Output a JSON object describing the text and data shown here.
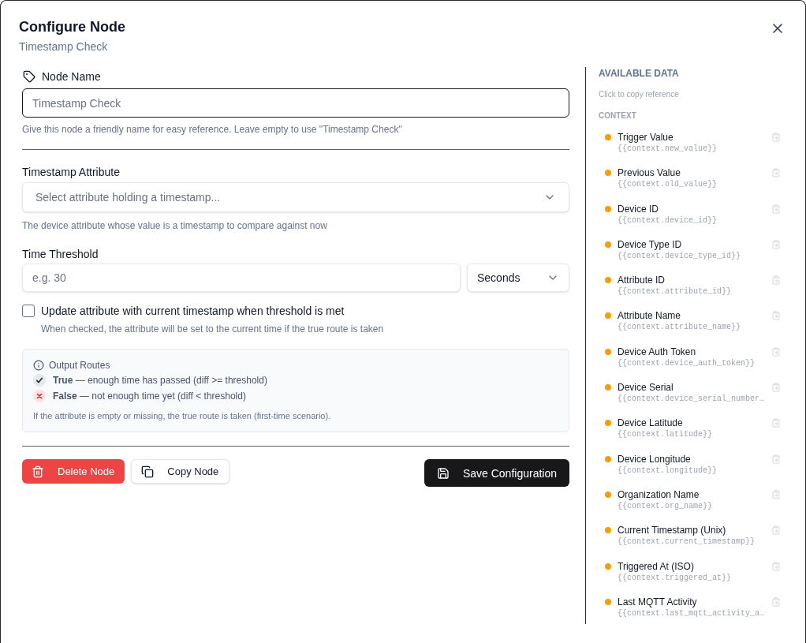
{
  "dialog": {
    "title": "Configure Node",
    "subtitle": "Timestamp Check"
  },
  "form": {
    "node_name": {
      "label": "Node Name",
      "placeholder": "Timestamp Check",
      "focused": true,
      "help": "Give this node a friendly name for easy reference. Leave empty to use \"Timestamp Check\""
    },
    "timestamp_attribute": {
      "label": "Timestamp Attribute",
      "placeholder": "Select attribute holding a timestamp...",
      "help": "The device attribute whose value is a timestamp to compare against now"
    },
    "time_threshold": {
      "label": "Time Threshold",
      "placeholder": "e.g. 30",
      "unit": "Seconds"
    },
    "update_checkbox": {
      "label": "Update attribute with current timestamp when threshold is met",
      "checked": false,
      "help": "When checked, the attribute will be set to the current time if the true route is taken"
    },
    "output_routes": {
      "title": "Output Routes",
      "routes": [
        {
          "kind": "pass",
          "text": "**True** — enough time has passed (diff >= threshold)"
        },
        {
          "kind": "fail",
          "text": "**False** — not enough time yet (diff < threshold)"
        }
      ],
      "note": "If the attribute is empty or missing, the true route is taken (first-time scenario)."
    }
  },
  "actions": [
    {
      "kind": "delete",
      "label": "Delete Node"
    },
    {
      "kind": "copy",
      "label": "Copy Node"
    },
    {
      "kind": "save",
      "label": "Save Configuration"
    }
  ],
  "available_data": {
    "title": "AVAILABLE DATA",
    "hint": "Click to copy reference",
    "section": "CONTEXT",
    "items": [
      {
        "label": "Trigger Value",
        "ref": "{{context.new_value}}"
      },
      {
        "label": "Previous Value",
        "ref": "{{context.old_value}}"
      },
      {
        "label": "Device ID",
        "ref": "{{context.device_id}}"
      },
      {
        "label": "Device Type ID",
        "ref": "{{context.device_type_id}}"
      },
      {
        "label": "Attribute ID",
        "ref": "{{context.attribute_id}}"
      },
      {
        "label": "Attribute Name",
        "ref": "{{context.attribute_name}}"
      },
      {
        "label": "Device Auth Token",
        "ref": "{{context.device_auth_token}}"
      },
      {
        "label": "Device Serial",
        "ref": "{{context.device_serial_number…"
      },
      {
        "label": "Device Latitude",
        "ref": "{{context.latitude}}"
      },
      {
        "label": "Device Longitude",
        "ref": "{{context.longitude}}"
      },
      {
        "label": "Organization Name",
        "ref": "{{context.org_name}}"
      },
      {
        "label": "Current Timestamp (Unix)",
        "ref": "{{context.current_timestamp}}"
      },
      {
        "label": "Triggered At (ISO)",
        "ref": "{{context.triggered_at}}"
      },
      {
        "label": "Last MQTT Activity",
        "ref": "{{context.last_mqtt_activity_a…"
      }
    ]
  }
}
